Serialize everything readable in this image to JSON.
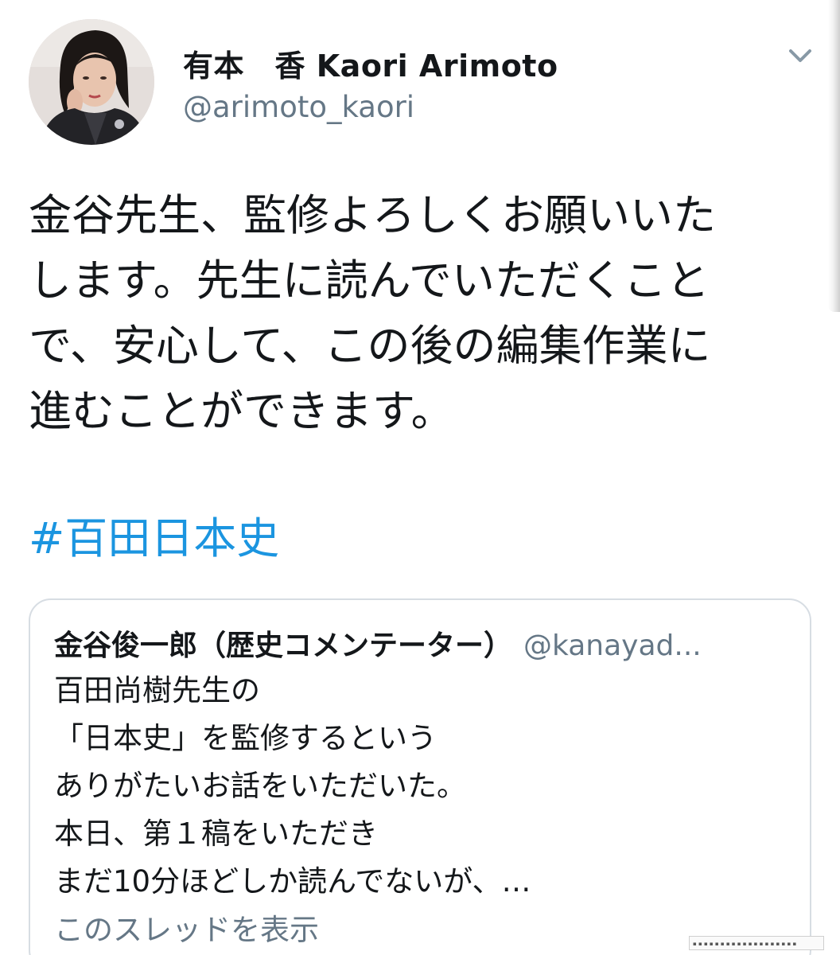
{
  "tweet": {
    "display_name": "有本　香  Kaori Arimoto",
    "handle": "@arimoto_kaori",
    "text": "金谷先生、監修よろしくお願いいた\nします。先生に読んでいただくこと\nで、安心して、この後の編集作業に\n進むことができます。",
    "hashtag": "#百田日本史",
    "caret_icon": "chevron-down-icon"
  },
  "quoted_tweet": {
    "display_name": "金谷俊一郎（歴史コメンテーター）",
    "handle": "@kanayad...",
    "text": "百田尚樹先生の\n「日本史」を監修するという\nありがたいお話をいただいた。\n本日、第１稿をいただき\nまだ10分ほどしか読んでないが、…",
    "show_thread": "このスレッドを表示"
  },
  "colors": {
    "text_primary": "#14171a",
    "text_secondary": "#657786",
    "link": "#1b95e0",
    "border": "#d7dde3"
  }
}
